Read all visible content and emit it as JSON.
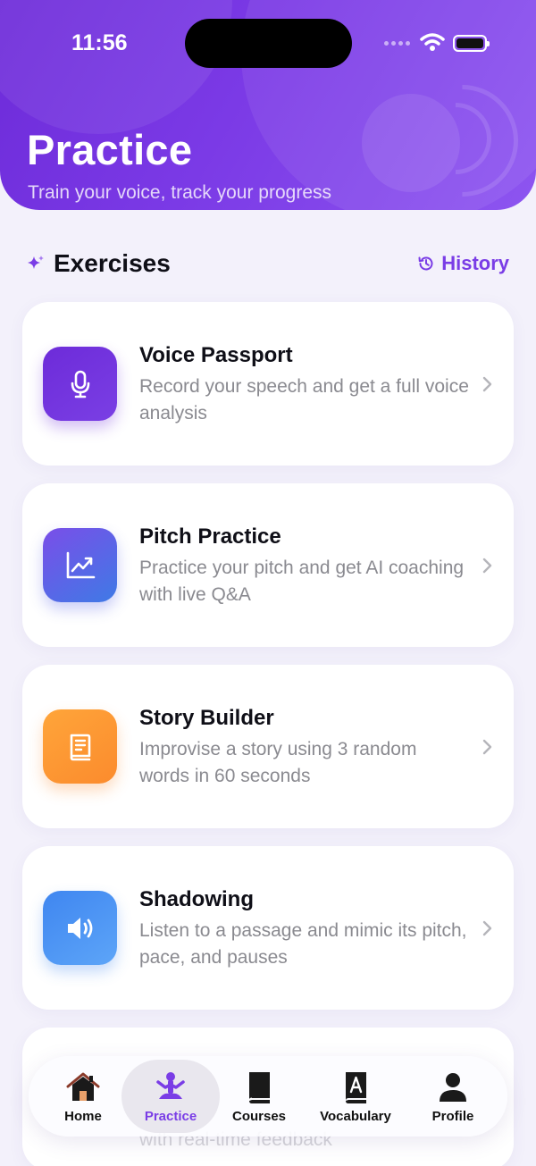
{
  "status_bar": {
    "time": "11:56"
  },
  "header": {
    "title": "Practice",
    "subtitle": "Train your voice, track your progress"
  },
  "exercises": {
    "section_title": "Exercises",
    "history_label": "History",
    "items": [
      {
        "title": "Voice Passport",
        "description": "Record your speech and get a full voice analysis",
        "icon": "microphone-icon"
      },
      {
        "title": "Pitch Practice",
        "description": "Practice your pitch and get AI coaching with live Q&A",
        "icon": "chart-line-icon"
      },
      {
        "title": "Story Builder",
        "description": "Improvise a story using 3 random words in 60 seconds",
        "icon": "book-icon"
      },
      {
        "title": "Shadowing",
        "description": "Listen to a passage and mimic its pitch, pace, and pauses",
        "icon": "speaker-icon"
      }
    ],
    "partial_item_desc": "with real-time feedback"
  },
  "tabbar": {
    "tabs": [
      {
        "label": "Home",
        "icon": "home-icon"
      },
      {
        "label": "Practice",
        "icon": "meditation-icon",
        "active": true
      },
      {
        "label": "Courses",
        "icon": "book-closed-icon"
      },
      {
        "label": "Vocabulary",
        "icon": "dictionary-icon"
      },
      {
        "label": "Profile",
        "icon": "person-icon"
      }
    ]
  },
  "colors": {
    "accent": "#7a3de6",
    "header_gradient_start": "#6d2bd9",
    "header_gradient_end": "#8d55f0"
  }
}
